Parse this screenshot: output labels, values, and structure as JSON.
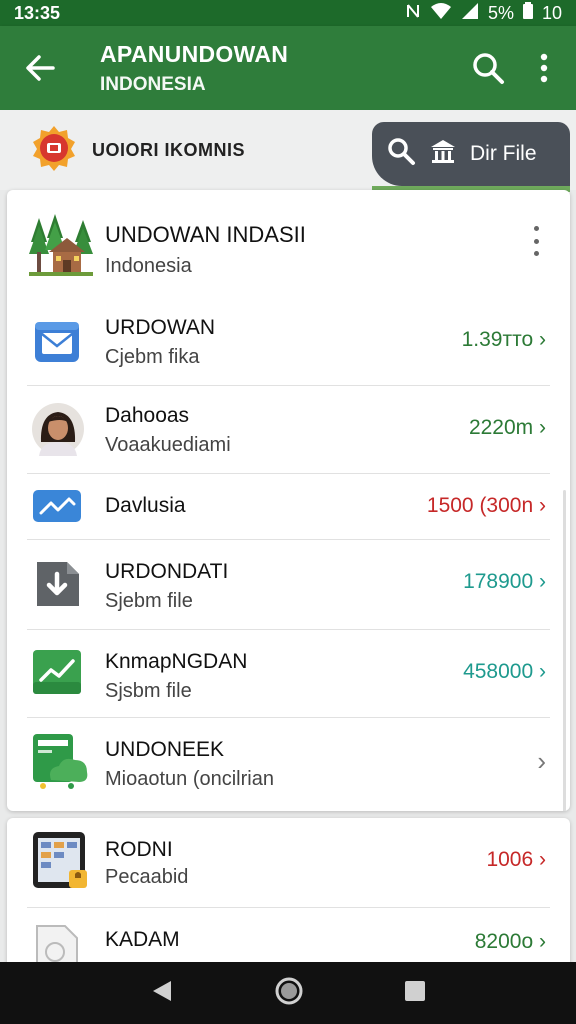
{
  "status_bar": {
    "time": "13:35",
    "battery_text": "5%",
    "extra": "10",
    "nfc_icon": "nfc-icon",
    "wifi_icon": "wifi-icon",
    "signal_icon": "signal-icon",
    "battery_icon": "battery-icon"
  },
  "app_bar": {
    "title": "APANUNDOWAN",
    "subtitle": "INDONESIA",
    "back_icon": "arrow-back-icon",
    "search_icon": "search-icon",
    "more_icon": "more-vertical-icon",
    "color": "#2f7d3b"
  },
  "sub_header": {
    "brand_name": "UOIORI IKOMNIS",
    "dir_button_label": "Dir File"
  },
  "card_main": {
    "header": {
      "name": "UNDOWAN INDASII",
      "sub": "Indonesia"
    },
    "rows": [
      {
        "title": "URDOWAN",
        "subtitle": "Cjebm fika",
        "value": "1.39тто",
        "value_color": "green",
        "icon": "email-icon"
      },
      {
        "title": "Dahooas",
        "subtitle": "Voaakuediami",
        "value": "2220m",
        "value_color": "green",
        "icon": "avatar"
      },
      {
        "title": "Davlusia",
        "subtitle": "",
        "value": "1500 (300n",
        "value_color": "red",
        "icon": "chart-icon"
      },
      {
        "title": "URDONDATI",
        "subtitle": "Sjebm file",
        "value": "178900",
        "value_color": "teal",
        "icon": "download-icon"
      },
      {
        "title": "KnmaрNGDAN",
        "subtitle": "Sjsbm file",
        "value": "458000",
        "value_color": "teal",
        "icon": "trend-icon"
      },
      {
        "title": "UNDONEEK",
        "subtitle": "Mioaotun (oncilrian",
        "value": "",
        "value_color": "gray",
        "icon": "cloud-device-icon"
      }
    ]
  },
  "card_second": {
    "rows": [
      {
        "title": "RODNI",
        "subtitle": "Pecaabid",
        "value": "1006",
        "value_color": "red",
        "icon": "tablet-icon"
      },
      {
        "title": "KADAM",
        "subtitle": "",
        "value": "8200o",
        "value_color": "green",
        "icon": "document-icon"
      }
    ]
  },
  "nav_bar": {
    "back_icon": "nav-back-icon",
    "home_icon": "nav-home-icon",
    "recents_icon": "nav-recents-icon"
  },
  "colors": {
    "accent_green": "#2c7a36",
    "accent_red": "#c62828",
    "accent_teal": "#1e9a8e"
  }
}
